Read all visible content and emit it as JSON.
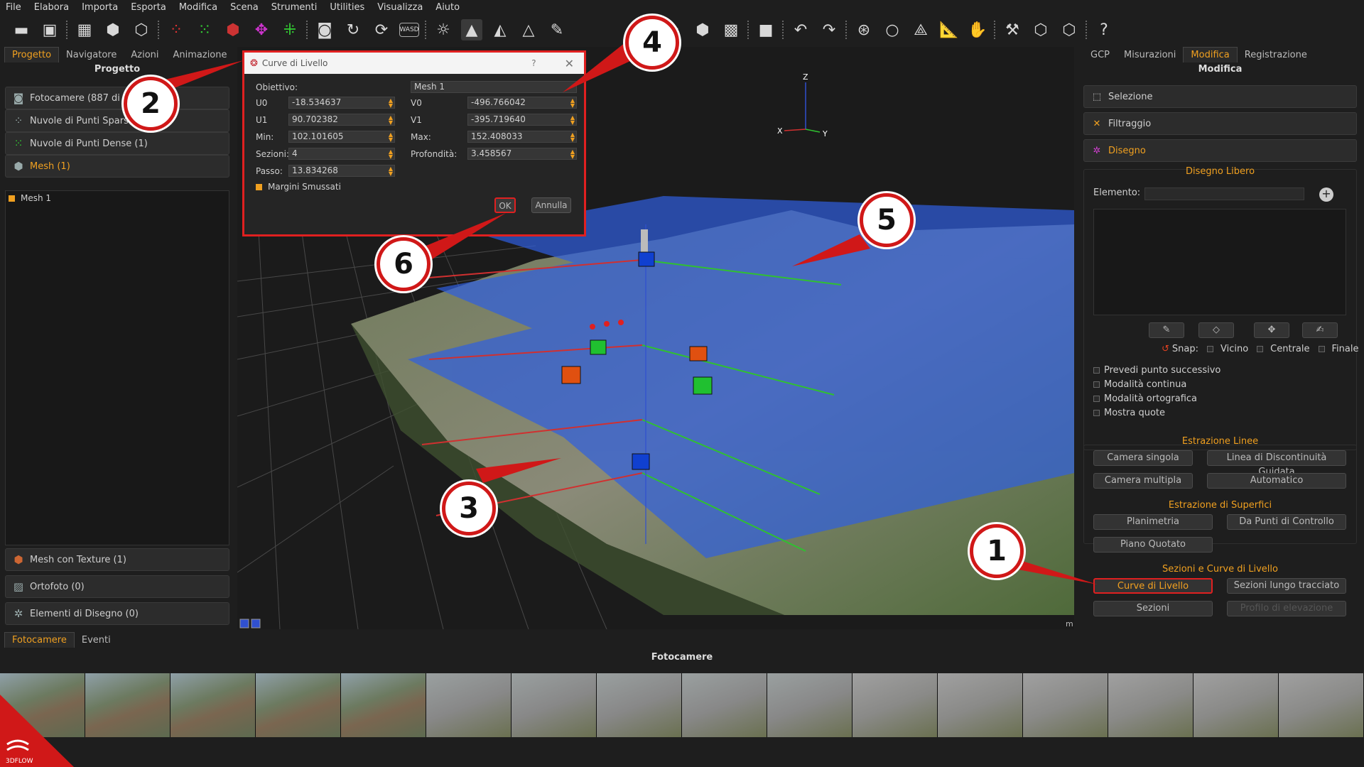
{
  "menu": [
    "File",
    "Elabora",
    "Importa",
    "Esporta",
    "Modifica",
    "Scena",
    "Strumenti",
    "Utilities",
    "Visualizza",
    "Aiuto"
  ],
  "toolbar": {
    "icons": [
      "open-folder-icon",
      "save-icon",
      "separator",
      "grid-select-icon",
      "cube-icon",
      "box-icon",
      "separator",
      "sparse-points-icon",
      "dense-points-icon",
      "mesh-icon",
      "textured-mesh-icon",
      "point-cloud-icon",
      "separator",
      "camera-icon",
      "rotate-icon",
      "orbit-icon",
      "wasd-icon",
      "separator",
      "light-bulb-icon",
      "solid-triangle-icon",
      "wire-triangle-icon",
      "outline-triangle-icon",
      "brush-icon"
    ],
    "right_icons": [
      "scatter-icon",
      "sphere-icon",
      "box-icon",
      "separator",
      "square-icon",
      "separator",
      "undo-icon",
      "redo-icon",
      "separator",
      "lasso-icon",
      "circle-icon",
      "plane-icon",
      "ruler-icon",
      "hand-icon",
      "separator",
      "wrench-icon",
      "logo-cube-icon",
      "logo-cube-alt-icon",
      "help-icon"
    ],
    "wasd_label": "WASD"
  },
  "left_panel": {
    "tabs": [
      "Progetto",
      "Navigatore",
      "Azioni",
      "Animazione"
    ],
    "active_tab": "Progetto",
    "title": "Progetto",
    "items": [
      {
        "label": "Fotocamere (887 di",
        "icon": "camera-icon"
      },
      {
        "label": "Nuvole di Punti Spars",
        "icon": "sparse-points-icon"
      },
      {
        "label": "Nuvole di Punti Dense (1)",
        "icon": "dense-points-icon"
      },
      {
        "label": "Mesh (1)",
        "icon": "mesh-icon",
        "highlight": true
      }
    ],
    "tree_item": "Mesh 1",
    "bottom_items": [
      {
        "label": "Mesh con Texture (1)",
        "icon": "textured-mesh-icon"
      },
      {
        "label": "Ortofoto (0)",
        "icon": "orthophoto-icon"
      },
      {
        "label": "Elementi di Disegno (0)",
        "icon": "drawing-elements-icon"
      }
    ]
  },
  "dialog": {
    "title": "Curve di Livello",
    "help": "?",
    "obiettivo_label": "Obiettivo:",
    "obiettivo_value": "Mesh 1",
    "u0_label": "U0",
    "u0": "-18.534637",
    "v0_label": "V0",
    "v0": "-496.766042",
    "u1_label": "U1",
    "u1": "90.702382",
    "v1_label": "V1",
    "v1": "-395.719640",
    "min_label": "Min:",
    "min": "102.101605",
    "max_label": "Max:",
    "max": "152.408033",
    "sezioni_label": "Sezioni:",
    "sezioni": "4",
    "profondita_label": "Profondità:",
    "profondita": "3.458567",
    "passo_label": "Passo:",
    "passo": "13.834268",
    "margini_label": "Margini Smussati",
    "ok": "OK",
    "annulla": "Annulla"
  },
  "axes": {
    "z": "Z",
    "x": "X",
    "y": "Y"
  },
  "viewport_unit": "m",
  "right_panel": {
    "tabs": [
      "GCP",
      "Misurazioni",
      "Modifica",
      "Registrazione"
    ],
    "active_tab": "Modifica",
    "title": "Modifica",
    "headers": [
      {
        "label": "Selezione",
        "icon": "selection-icon"
      },
      {
        "label": "Filtraggio",
        "icon": "filter-icon"
      },
      {
        "label": "Disegno",
        "icon": "draw-icon"
      }
    ],
    "disegno_libero": "Disegno Libero",
    "elemento_label": "Elemento:",
    "snap_label": "Snap:",
    "snap_options": [
      "Vicino",
      "Centrale",
      "Finale"
    ],
    "checkboxes": [
      "Prevedi punto successivo",
      "Modalità continua",
      "Modalità ortografica",
      "Mostra quote"
    ],
    "estrazione_linee": "Estrazione Linee",
    "linee_buttons": [
      "Camera singola",
      "Linea di Discontinuità Guidata",
      "Camera multipla",
      "Automatico"
    ],
    "estrazione_superfici": "Estrazione di Superfici",
    "superfici_buttons": [
      "Planimetria",
      "Da Punti di Controllo",
      "Piano Quotato"
    ],
    "sezioni_curve": "Sezioni e Curve di Livello",
    "sezioni_buttons": [
      "Curve di Livello",
      "Sezioni lungo tracciato",
      "Sezioni",
      "Profilo di elevazione"
    ]
  },
  "bottom": {
    "tabs": [
      "Fotocamere",
      "Eventi"
    ],
    "active_tab": "Fotocamere",
    "title": "Fotocamere",
    "logo": "3DFLOW"
  },
  "callouts": [
    "1",
    "2",
    "3",
    "4",
    "5",
    "6"
  ],
  "colors": {
    "accent": "#f0a020",
    "highlight": "#e02020",
    "plane": "#2f5fe0",
    "cube_red": "#e05010",
    "cube_green": "#20c030",
    "cube_blue": "#1040d0"
  }
}
